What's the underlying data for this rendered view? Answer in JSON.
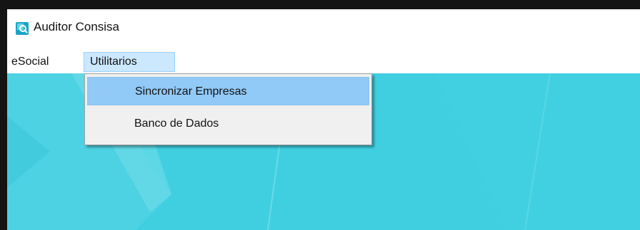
{
  "window": {
    "title": "Auditor Consisa",
    "icon": "app-logo-icon",
    "content_background": "#3fcfe0"
  },
  "menubar": {
    "items": [
      {
        "label": "eSocial",
        "state": "normal"
      },
      {
        "label": "Utilitarios",
        "state": "open"
      }
    ]
  },
  "dropdown": {
    "parent": "Utilitarios",
    "items": [
      {
        "label": "Sincronizar Empresas",
        "state": "highlighted"
      },
      {
        "label": "Banco de Dados",
        "state": "normal"
      }
    ]
  },
  "colors": {
    "menu_open_bg": "#cce8ff",
    "item_highlight_bg": "#91c9f7",
    "dropdown_bg": "#f0f0f0"
  }
}
